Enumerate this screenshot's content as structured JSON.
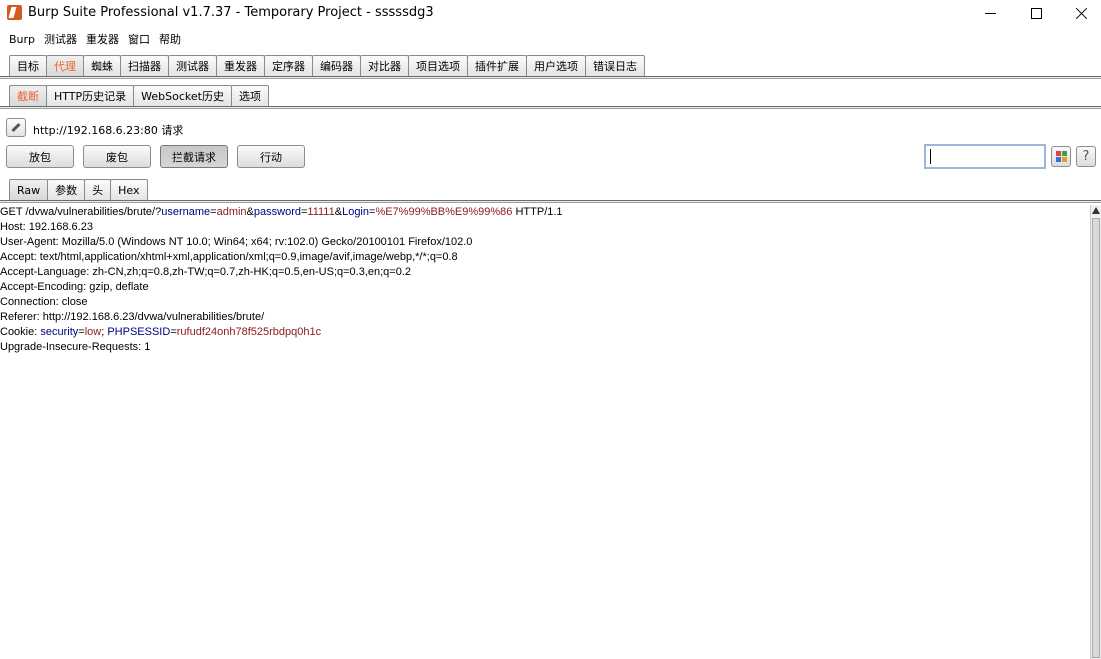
{
  "window": {
    "title": "Burp Suite Professional v1.7.37 - Temporary Project - sssssdg3"
  },
  "menu": [
    "Burp",
    "测试器",
    "重发器",
    "窗口",
    "帮助"
  ],
  "main_tabs": [
    "目标",
    "代理",
    "蜘蛛",
    "扫描器",
    "测试器",
    "重发器",
    "定序器",
    "编码器",
    "对比器",
    "项目选项",
    "插件扩展",
    "用户选项",
    "错误日志"
  ],
  "main_tab_active": "代理",
  "proxy_tabs": [
    "截断",
    "HTTP历史记录",
    "WebSocket历史",
    "选项"
  ],
  "proxy_tab_active": "截断",
  "intercept": {
    "request_label": "http://192.168.6.23:80 请求",
    "forward_label": "放包",
    "drop_label": "废包",
    "intercept_label": "拦截请求",
    "action_label": "行动",
    "search_value": ""
  },
  "editor_tabs": [
    "Raw",
    "参数",
    "头",
    "Hex"
  ],
  "editor_tab_active": "Raw",
  "request": {
    "line1": {
      "prefix": "GET /dvwa/vulnerabilities/brute/?",
      "p1_name": "username",
      "p1_value": "admin",
      "p2_name": "password",
      "p2_value": "11111",
      "p3_name": "Login",
      "p3_value": "%E7%99%BB%E9%99%86",
      "suffix": " HTTP/1.1"
    },
    "headers": [
      "Host: 192.168.6.23",
      "User-Agent: Mozilla/5.0 (Windows NT 10.0; Win64; x64; rv:102.0) Gecko/20100101 Firefox/102.0",
      "Accept: text/html,application/xhtml+xml,application/xml;q=0.9,image/avif,image/webp,*/*;q=0.8",
      "Accept-Language: zh-CN,zh;q=0.8,zh-TW;q=0.7,zh-HK;q=0.5,en-US;q=0.3,en;q=0.2",
      "Accept-Encoding: gzip, deflate",
      "Connection: close",
      "Referer: http://192.168.6.23/dvwa/vulnerabilities/brute/"
    ],
    "cookie": {
      "prefix": "Cookie: ",
      "c1_name": "security",
      "c1_value": "low",
      "c2_name": "PHPSESSID",
      "c2_value": "rufudf24onh78f525rbdpq0h1c"
    },
    "last_header": "Upgrade-Insecure-Requests: 1"
  },
  "colors": {
    "active_tab_text": "#e8632a",
    "param_name": "#000080",
    "param_value": "#8b1a1a"
  },
  "icons": [
    "burp-app-icon",
    "minimize-icon",
    "maximize-icon",
    "close-icon",
    "pencil-icon",
    "color-grid-icon",
    "help-icon"
  ]
}
